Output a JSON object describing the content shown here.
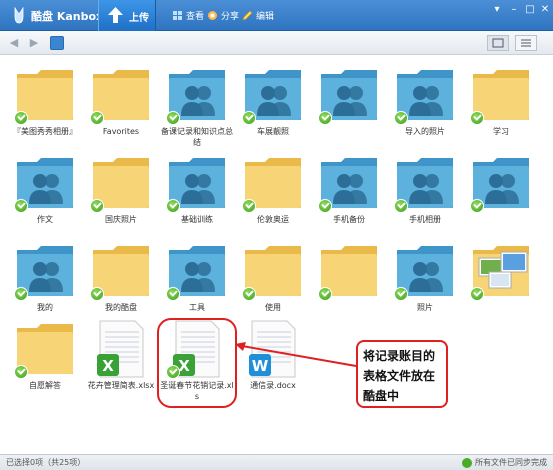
{
  "app": {
    "title": "酷盘 Kanbox"
  },
  "titlebar": {
    "upload_label": "上传",
    "tools": [
      {
        "label": "查看",
        "icon": "view-icon"
      },
      {
        "label": "分享",
        "icon": "share-icon"
      },
      {
        "label": "编辑",
        "icon": "edit-icon"
      }
    ]
  },
  "files": [
    {
      "label": "『美图秀秀相册』",
      "type": "folder"
    },
    {
      "label": "Favorites",
      "type": "folder"
    },
    {
      "label": "备课记录和知识点总结",
      "type": "shared-folder"
    },
    {
      "label": "车展靓照",
      "type": "shared-folder"
    },
    {
      "label": "",
      "type": "shared-folder"
    },
    {
      "label": "导入的照片",
      "type": "shared-folder"
    },
    {
      "label": "学习",
      "type": "folder"
    },
    {
      "label": "作文",
      "type": "shared-folder"
    },
    {
      "label": "国庆照片",
      "type": "folder"
    },
    {
      "label": "基础训练",
      "type": "shared-folder"
    },
    {
      "label": "伦敦奥运",
      "type": "folder"
    },
    {
      "label": "手机备份",
      "type": "shared-folder"
    },
    {
      "label": "手机相册",
      "type": "shared-folder"
    },
    {
      "label": "",
      "type": "shared-folder"
    },
    {
      "label": "我的",
      "type": "shared-folder"
    },
    {
      "label": "我的酷盘",
      "type": "folder"
    },
    {
      "label": "工具",
      "type": "shared-folder"
    },
    {
      "label": "使用",
      "type": "folder"
    },
    {
      "label": "",
      "type": "folder"
    },
    {
      "label": "照片",
      "type": "shared-folder"
    },
    {
      "label": "",
      "type": "image-folder"
    },
    {
      "label": "自愿解答",
      "type": "folder"
    },
    {
      "label": "花卉管理简表.xlsx",
      "type": "xlsx",
      "synced": false
    },
    {
      "label": "圣诞春节花销记录.xls",
      "type": "xls"
    },
    {
      "label": "通信录.docx",
      "type": "docx",
      "synced": false
    }
  ],
  "status": {
    "left": "已选择0项（共25项）",
    "right": "所有文件已同步完成"
  },
  "annotation": {
    "callout_text": "将记录账目的表格文件放在酷盘中"
  },
  "colors": {
    "accent": "#2f74c0",
    "folder": "#f6cf67",
    "shared_folder": "#5aaed6",
    "sync_check": "#4aab24",
    "annotation": "#e02020"
  }
}
